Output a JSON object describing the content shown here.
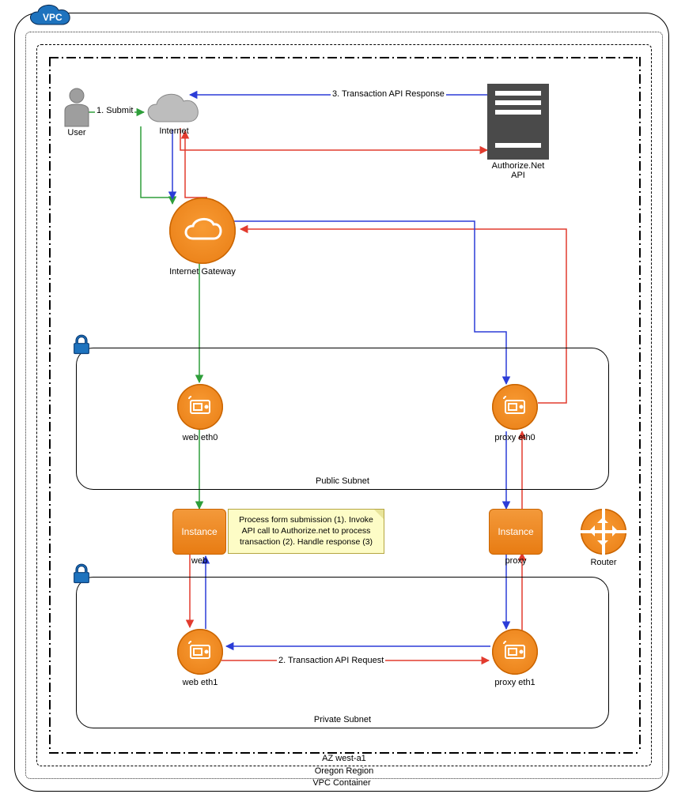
{
  "diagram_title": "AWS VPC payment-flow architecture",
  "badge": {
    "vpc": "VPC"
  },
  "containers": {
    "vpc_container": "VPC Container",
    "region": "Oregon Region",
    "az": "AZ west-a1",
    "public_subnet": "Public Subnet",
    "private_subnet": "Private Subnet"
  },
  "nodes": {
    "user": "User",
    "internet": "Internet",
    "igw": "Internet Gateway",
    "authorize_api": "Authorize.Net\nAPI",
    "web_eth0": "web eth0",
    "proxy_eth0": "proxy eth0",
    "web_instance_box": "Instance",
    "web_instance_label": "web",
    "proxy_instance_box": "Instance",
    "proxy_instance_label": "proxy",
    "web_eth1": "web eth1",
    "proxy_eth1": "proxy eth1",
    "router": "Router"
  },
  "edge_labels": {
    "submit": "1. Submit",
    "api_request": "2. Transaction API Request",
    "api_response": "3. Transaction API Response"
  },
  "note": "Process form submission (1). Invoke API call to Authorize.net to process transaction (2). Handle response (3)",
  "colors": {
    "flow_green": "#2e9e3a",
    "flow_red": "#e23b2e",
    "flow_blue": "#2b3cd7",
    "orange": "#e87c13",
    "vpc_blue": "#1e73be",
    "server_grey": "#4a4a4a",
    "cloud_grey": "#bdbdbd"
  },
  "flows": [
    {
      "id": 1,
      "label": "1. Submit",
      "color": "green",
      "path": [
        "User",
        "Internet",
        "Internet Gateway",
        "web eth0",
        "web Instance"
      ]
    },
    {
      "id": 2,
      "label": "2. Transaction API Request",
      "color": "red",
      "path": [
        "web Instance",
        "web eth1",
        "proxy eth1",
        "proxy Instance",
        "proxy eth0",
        "Internet Gateway",
        "Internet",
        "Authorize.Net API"
      ]
    },
    {
      "id": 3,
      "label": "3. Transaction API Response",
      "color": "blue",
      "path": [
        "Authorize.Net API",
        "Internet",
        "Internet Gateway",
        "proxy eth0",
        "proxy Instance",
        "proxy eth1",
        "web eth1",
        "web Instance"
      ]
    }
  ]
}
